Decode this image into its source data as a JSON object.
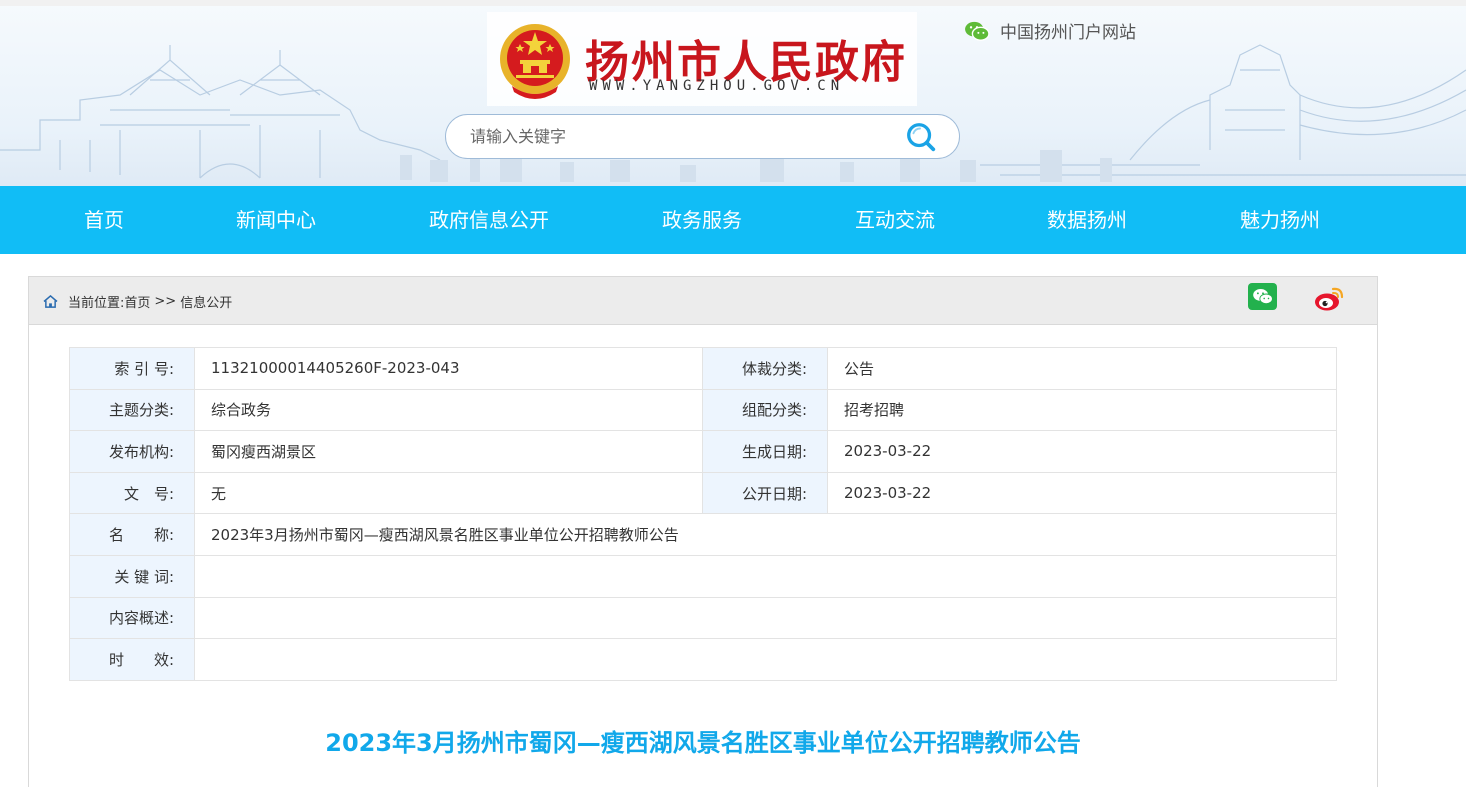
{
  "header": {
    "site_title": "扬州市人民政府",
    "site_url": "WWW.YANGZHOU.GOV.CN",
    "portal_link": "中国扬州门户网站",
    "portal_icon": "wechat-icon",
    "search": {
      "placeholder": "请输入关键字",
      "button_icon": "search-icon"
    },
    "emblem": "national-emblem"
  },
  "nav": {
    "items": [
      {
        "label": "首页"
      },
      {
        "label": "新闻中心"
      },
      {
        "label": "政府信息公开"
      },
      {
        "label": "政务服务"
      },
      {
        "label": "互动交流"
      },
      {
        "label": "数据扬州"
      },
      {
        "label": "魅力扬州"
      }
    ]
  },
  "breadcrumb": {
    "prefix": "当前位置:",
    "items": [
      "首页",
      "信息公开"
    ],
    "separator": ">>"
  },
  "share": {
    "wechat_icon": "wechat-share-icon",
    "weibo_icon": "weibo-share-icon"
  },
  "info_table": {
    "index_no": {
      "label": "索 引 号:",
      "value": "11321000014405260F-2023-043"
    },
    "genre": {
      "label": "体裁分类:",
      "value": "公告"
    },
    "topic": {
      "label": "主题分类:",
      "value": "综合政务"
    },
    "assignment": {
      "label": "组配分类:",
      "value": "招考招聘"
    },
    "publisher": {
      "label": "发布机构:",
      "value": "蜀冈瘦西湖景区"
    },
    "created_date": {
      "label": "生成日期:",
      "value": "2023-03-22"
    },
    "doc_no": {
      "label": "文　号:",
      "value": "无"
    },
    "public_date": {
      "label": "公开日期:",
      "value": "2023-03-22"
    },
    "name": {
      "label": "名　　称:",
      "value": "2023年3月扬州市蜀冈—瘦西湖风景名胜区事业单位公开招聘教师公告"
    },
    "keywords": {
      "label": "关 键 词:",
      "value": ""
    },
    "summary": {
      "label": "内容概述:",
      "value": ""
    },
    "validity": {
      "label": "时　　效:",
      "value": ""
    }
  },
  "article": {
    "title": "2023年3月扬州市蜀冈—瘦西湖风景名胜区事业单位公开招聘教师公告"
  },
  "colors": {
    "nav_bg": "#11bdf6",
    "title_red": "#c8161d",
    "article_title": "#11a8ea",
    "label_bg": "#edf5fe"
  }
}
